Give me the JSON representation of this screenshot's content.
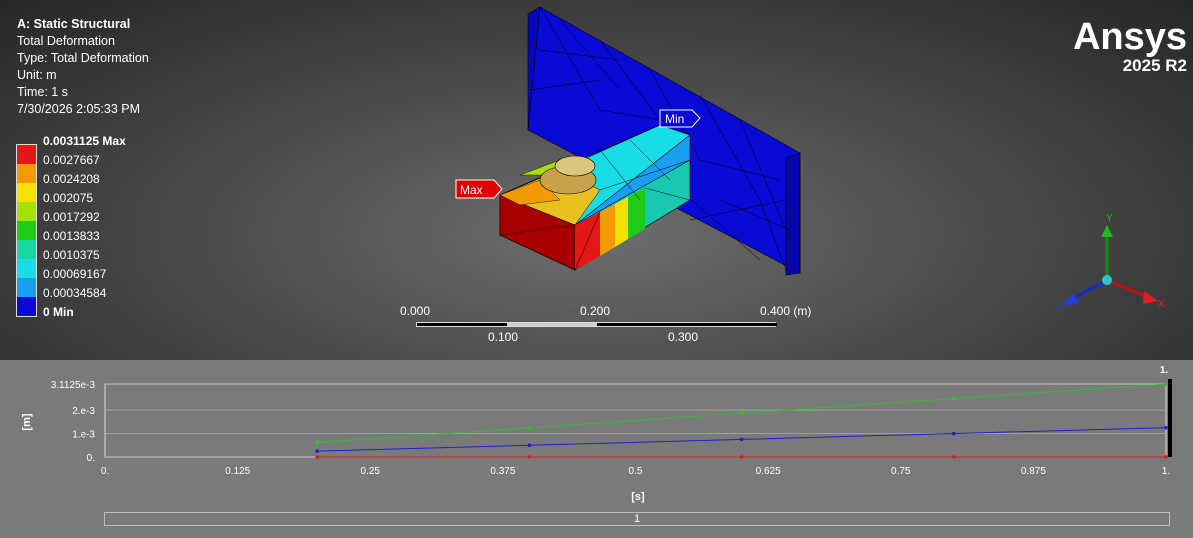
{
  "info": {
    "title": "A: Static Structural",
    "result": "Total Deformation",
    "type": "Type: Total Deformation",
    "unit": "Unit: m",
    "time": "Time: 1 s",
    "date": "7/30/2026 2:05:33 PM"
  },
  "legend": {
    "labels": [
      "0.0031125 Max",
      "0.0027667",
      "0.0024208",
      "0.002075",
      "0.0017292",
      "0.0013833",
      "0.0010375",
      "0.00069167",
      "0.00034584",
      "0 Min"
    ],
    "colors": [
      "#e41616",
      "#f29a05",
      "#f4e100",
      "#a6e000",
      "#1ecc18",
      "#1ad5a2",
      "#18dde6",
      "#1a9ef0",
      "#0a0ad6"
    ]
  },
  "brand": {
    "name": "Ansys",
    "version": "2025 R2"
  },
  "probes": {
    "max": "Max",
    "min": "Min"
  },
  "scale": {
    "top": [
      "0.000",
      "0.200",
      "0.400 (m)"
    ],
    "bottom": [
      "0.100",
      "0.300"
    ]
  },
  "triad": {
    "x": "X",
    "y": "Y",
    "z": "Z"
  },
  "graph": {
    "ylabel": "[m]",
    "xlabel": "[s]",
    "yticks": [
      "3.1125e-3",
      "2.e-3",
      "1.e-3",
      "0."
    ],
    "xticks": [
      "0.",
      "0.125",
      "0.25",
      "0.375",
      "0.5",
      "0.625",
      "0.75",
      "0.875",
      "1."
    ],
    "marker_label": "1.",
    "timeline_label": "1"
  },
  "chart_data": {
    "type": "line",
    "x": [
      0.2,
      0.4,
      0.6,
      0.8,
      1.0
    ],
    "series": [
      {
        "color": "#2fbf2f",
        "values": [
          0.00062,
          0.00124,
          0.00187,
          0.00249,
          0.0031125
        ]
      },
      {
        "color": "#2020d0",
        "values": [
          0.00025,
          0.0005,
          0.00075,
          0.001,
          0.00125
        ]
      },
      {
        "color": "#d02020",
        "values": [
          0.0,
          0.0,
          0.0,
          0.0,
          0.0
        ]
      }
    ],
    "ylim": [
      0,
      0.0031125
    ],
    "xlim": [
      0,
      1
    ],
    "grid": true
  }
}
